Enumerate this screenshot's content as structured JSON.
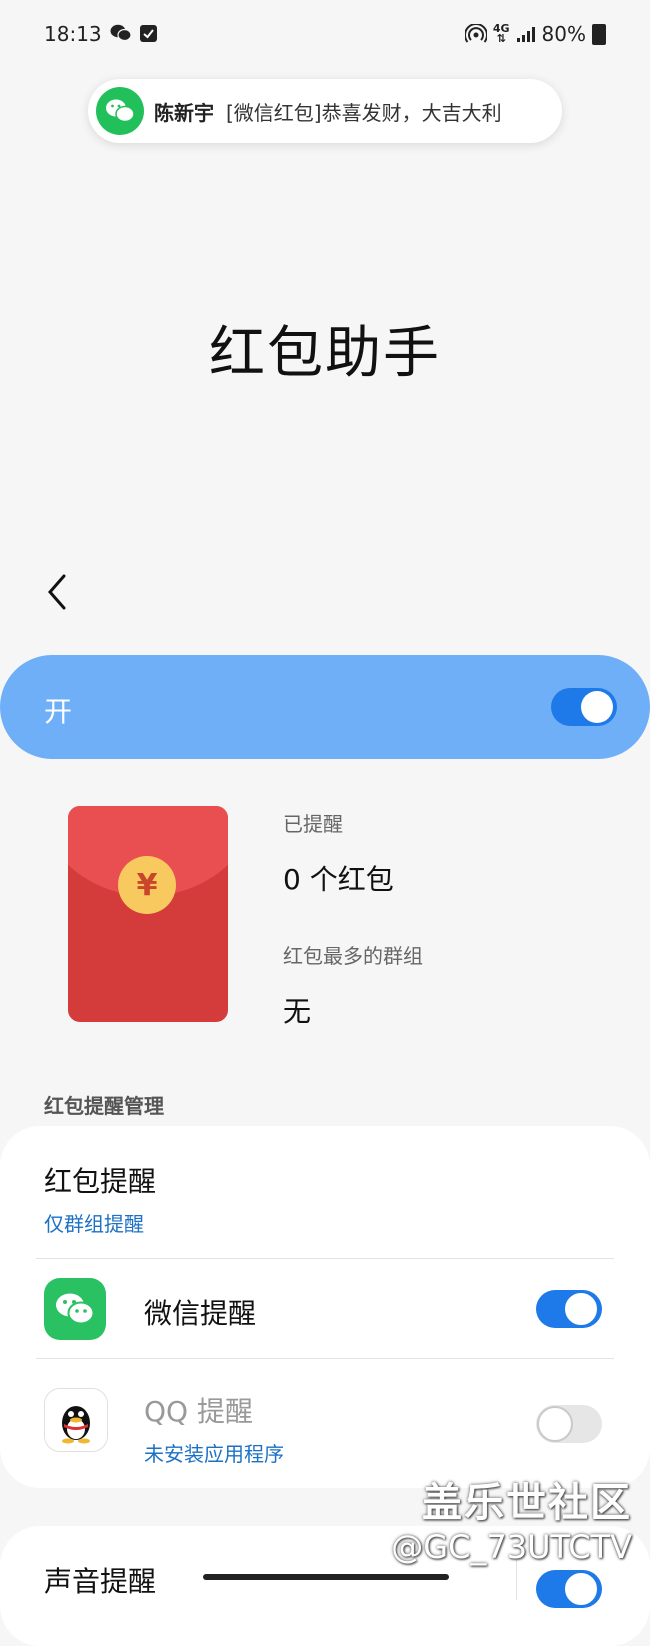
{
  "status_bar": {
    "time": "18:13",
    "network_label": "4G",
    "battery": "80%"
  },
  "notification": {
    "sender": "陈新宇",
    "message": "[微信红包]恭喜发财，大吉大利"
  },
  "page": {
    "title": "红包助手"
  },
  "master_switch": {
    "label": "开",
    "on": true
  },
  "stats": {
    "reminded_label": "已提醒",
    "reminded_value": "0 个红包",
    "top_group_label": "红包最多的群组",
    "top_group_value": "无"
  },
  "section": {
    "title": "红包提醒管理"
  },
  "settings": {
    "reminder": {
      "title": "红包提醒",
      "subtitle": "仅群组提醒"
    },
    "wechat": {
      "title": "微信提醒",
      "on": true
    },
    "qq": {
      "title": "QQ 提醒",
      "subtitle": "未安装应用程序",
      "on": false
    },
    "sound": {
      "title": "声音提醒",
      "on": true
    }
  },
  "watermark": {
    "line1": "盖乐世社区",
    "line2": "@GC_73UTCTV"
  },
  "colors": {
    "master_bar": "#6eaff7",
    "toggle_on": "#1e7ae8",
    "link": "#1d71c4",
    "envelope": "#d43b3b",
    "wechat_green": "#2ac163"
  }
}
